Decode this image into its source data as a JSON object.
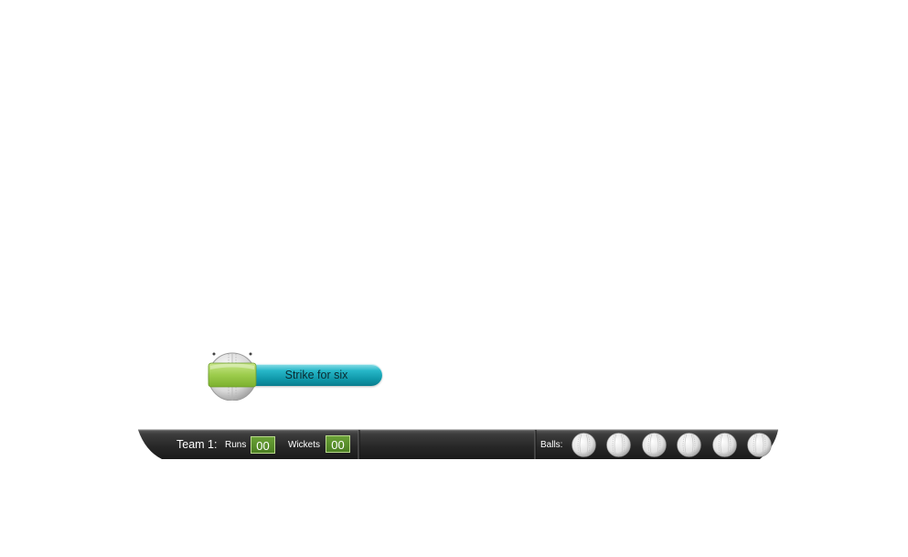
{
  "strike_button": {
    "label": "Strike for six"
  },
  "scoreboard": {
    "team_label": "Team 1:",
    "runs_label": "Runs",
    "runs_value": "00",
    "wickets_label": "Wickets",
    "wickets_value": "00",
    "balls_label": "Balls:",
    "balls_count": 6
  },
  "colors": {
    "strike_bar": "#27b7c8",
    "score_box": "#4b7f22",
    "strip_dark": "#222222"
  },
  "icons": {
    "strike_icon": "cricket-ball-icon",
    "ball_icon": "cricket-ball-icon"
  }
}
